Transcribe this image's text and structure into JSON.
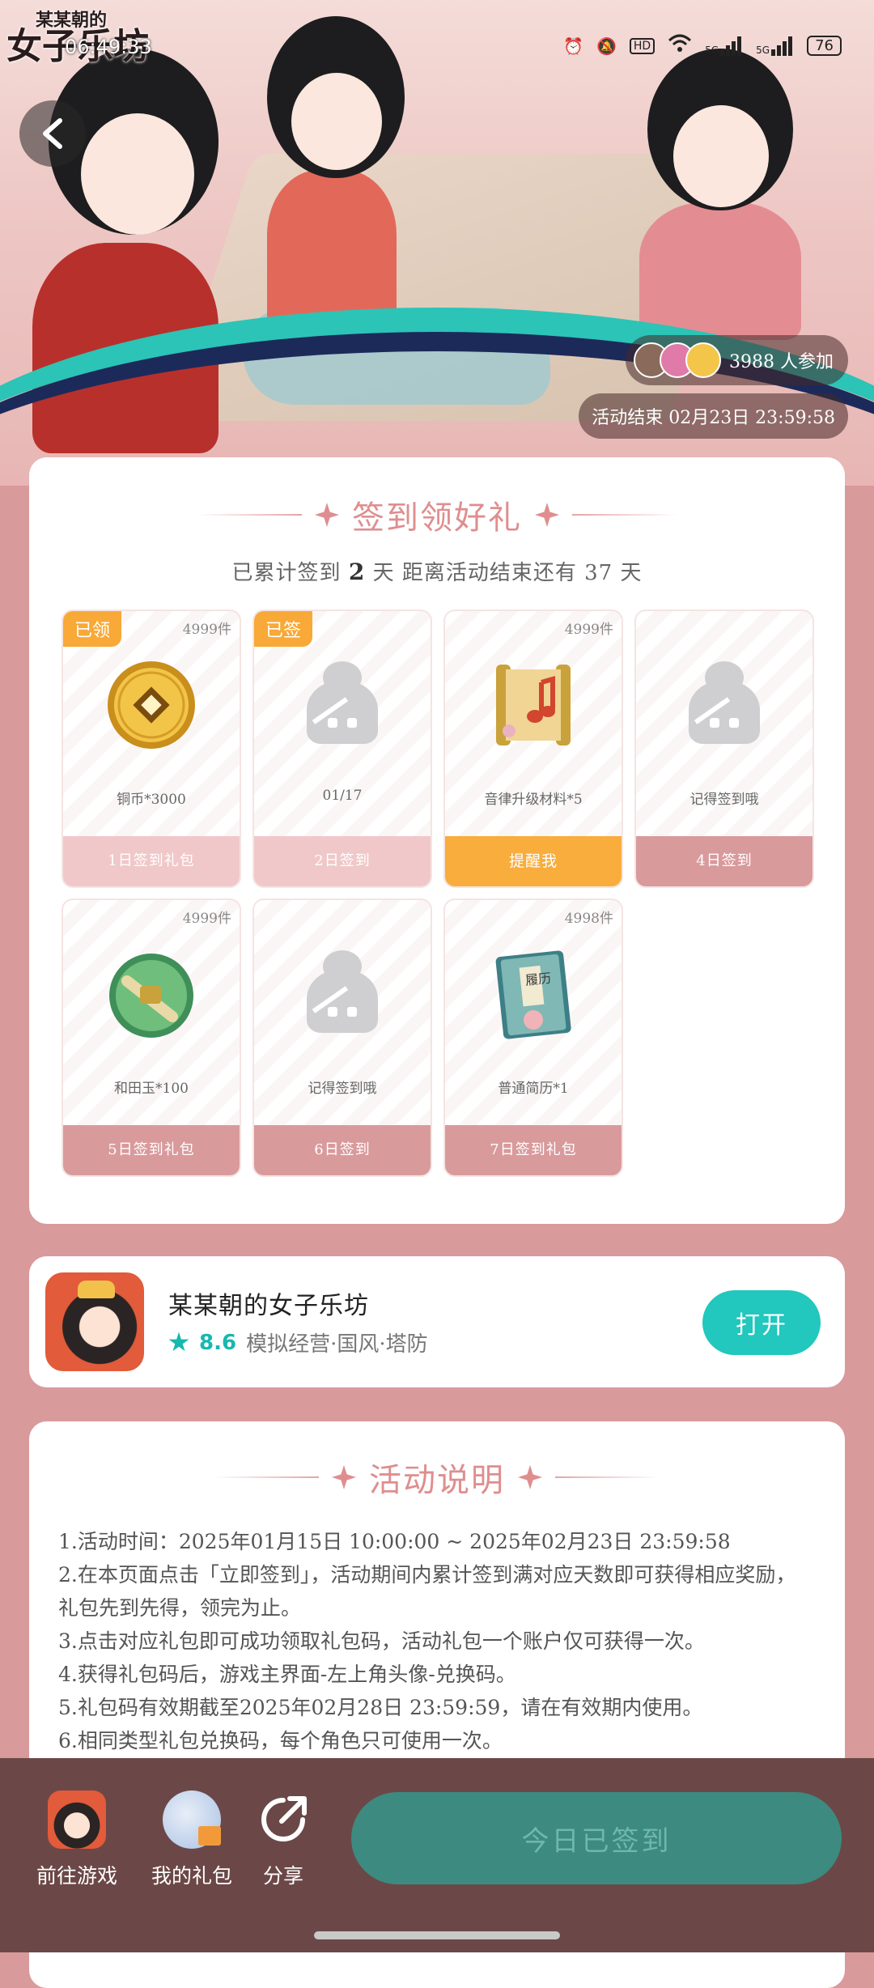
{
  "status_bar": {
    "time": "06:49:33",
    "battery": "76",
    "icons": [
      "alarm-icon",
      "mute-icon",
      "hd-icon",
      "wifi-icon",
      "signal-5g-icon",
      "signal-5g-icon"
    ],
    "hd": "HD",
    "net1": "5G",
    "net2": "5G"
  },
  "hero": {
    "logo_small": "某某朝的",
    "logo_big": "女子乐坊",
    "participants": "3988 人参加",
    "activity_end": "活动结束 02月23日 23:59:58"
  },
  "signin": {
    "title": "签到领好礼",
    "summary_prefix": "已累计签到",
    "days_signed": "2",
    "summary_mid": "天  距离活动结束还有 37 天",
    "rewards": [
      {
        "badge": "已领",
        "stock": "4999件",
        "icon": "copper-coin-icon",
        "name": "铜币*3000",
        "button": "1日签到礼包",
        "state": "done"
      },
      {
        "badge": "已签",
        "stock": "",
        "icon": "placeholder-figure-icon",
        "name": "01/17",
        "button": "2日签到",
        "state": "done"
      },
      {
        "badge": "",
        "stock": "4999件",
        "icon": "music-scroll-icon",
        "name": "音律升级材料*5",
        "button": "提醒我",
        "state": "remind"
      },
      {
        "badge": "",
        "stock": "",
        "icon": "placeholder-figure-icon",
        "name": "记得签到哦",
        "button": "4日签到",
        "state": "pending"
      },
      {
        "badge": "",
        "stock": "4999件",
        "icon": "jade-icon",
        "name": "和田玉*100",
        "button": "5日签到礼包",
        "state": "pending"
      },
      {
        "badge": "",
        "stock": "",
        "icon": "placeholder-figure-icon",
        "name": "记得签到哦",
        "button": "6日签到",
        "state": "pending"
      },
      {
        "badge": "",
        "stock": "4998件",
        "icon": "resume-book-icon",
        "name": "普通简历*1",
        "button": "7日签到礼包",
        "state": "pending"
      }
    ],
    "resume_label": "履历"
  },
  "game": {
    "name": "某某朝的女子乐坊",
    "rating": "8.6",
    "tags": "模拟经营·国风·塔防",
    "open_label": "打开"
  },
  "description": {
    "title": "活动说明",
    "rules": [
      "1.活动时间：2025年01月15日 10:00:00 ~ 2025年02月23日 23:59:58",
      "2.在本页面点击「立即签到」，活动期间内累计签到满对应天数即可获得相应奖励，礼包先到先得，领完为止。",
      "3.点击对应礼包即可成功领取礼包码，活动礼包一个账户仅可获得一次。",
      "4.获得礼包码后，游戏主界面-左上角头像-兑换码。",
      "5.礼包码有效期截至2025年02月28日 23:59:59，请在有效期内使用。",
      "6.相同类型礼包兑换码，每个角色只可使用一次。"
    ]
  },
  "bottom_bar": {
    "go_game": "前往游戏",
    "my_gifts": "我的礼包",
    "share": "分享",
    "signed_today": "今日已签到"
  },
  "colors": {
    "background": "#d99a9c",
    "accent_teal": "#22c7bd",
    "title_pink": "#df8e8f",
    "remind_orange": "#f8ad3c",
    "bottom_bar": "#6b4847",
    "signed_button": "#3d8a80"
  }
}
